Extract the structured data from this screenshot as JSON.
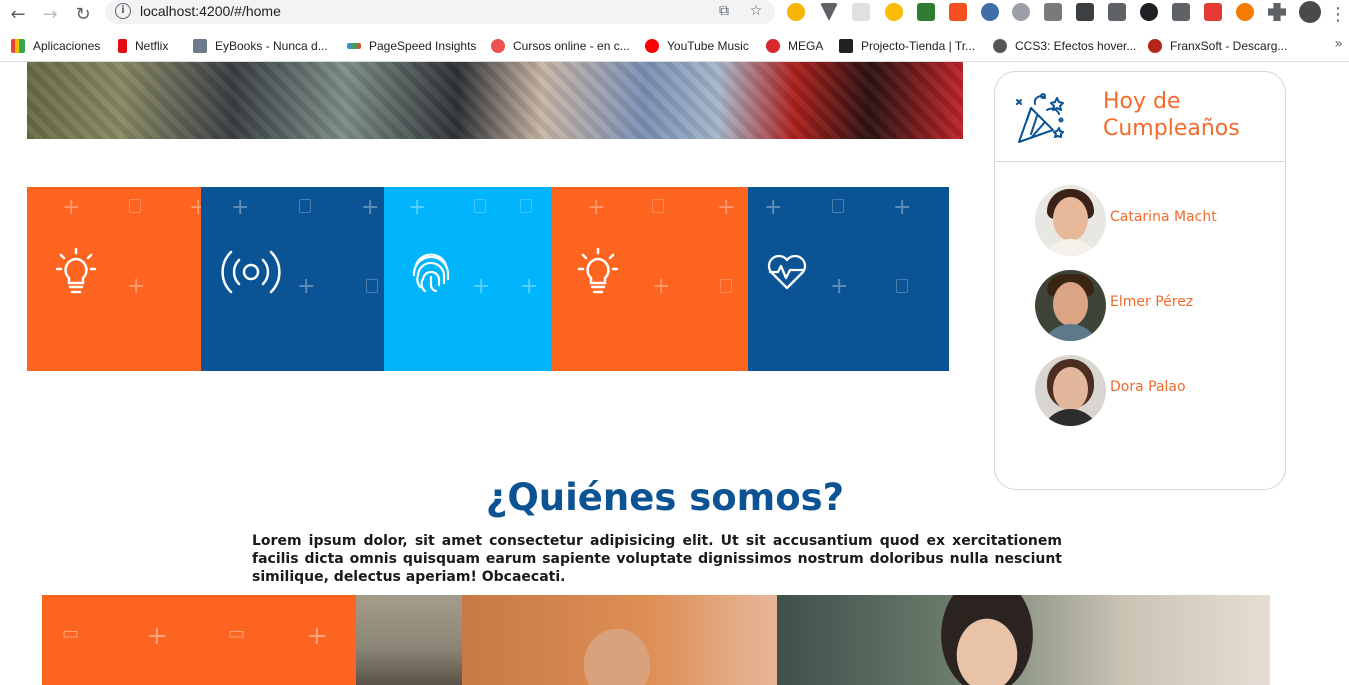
{
  "browser": {
    "url": "localhost:4200/#/home",
    "bookmarks": [
      {
        "label": "Aplicaciones",
        "color": "#4285f4"
      },
      {
        "label": "Netflix",
        "color": "#e50914"
      },
      {
        "label": "EyBooks - Nunca d...",
        "color": "#6d7b8d"
      },
      {
        "label": "PageSpeed Insights",
        "color": "#34a853"
      },
      {
        "label": "Cursos online - en c...",
        "color": "#ec5252"
      },
      {
        "label": "YouTube Music",
        "color": "#ff0000"
      },
      {
        "label": "MEGA",
        "color": "#d9272e"
      },
      {
        "label": "Projecto-Tienda | Tr...",
        "color": "#222222"
      },
      {
        "label": "CCS3: Efectos hover...",
        "color": "#555555"
      },
      {
        "label": "FranxSoft - Descarg...",
        "color": "#b3261e"
      }
    ],
    "more": "»"
  },
  "colors": {
    "orange": "#fd6420",
    "blue": "#0a5394",
    "light_blue": "#00b5fc",
    "accent": "#f26b2a",
    "heading": "#0c5394"
  },
  "tiles": [
    {
      "color": "#fd6420",
      "icon": "lightbulb-icon"
    },
    {
      "color": "#0a5394",
      "icon": "wireless-signal-icon"
    },
    {
      "color": "#00b5fc",
      "icon": "fingerprint-icon"
    },
    {
      "color": "#fd6420",
      "icon": "lightbulb-icon"
    },
    {
      "color": "#0a5394",
      "icon": "heart-pulse-icon"
    }
  ],
  "birthdays": {
    "title": "Hoy de Cumpleaños",
    "icon": "party-popper-icon",
    "people": [
      {
        "name": "Catarina Macht"
      },
      {
        "name": "Elmer Pérez"
      },
      {
        "name": "Dora Palao"
      }
    ]
  },
  "about": {
    "title": "¿Quiénes somos?",
    "text": "Lorem ipsum dolor, sit amet consectetur adipisicing elit. Ut sit accusantium quod ex xercitationem facilis dicta omnis quisquam earum sapiente voluptate dignissimos nostrum doloribus nulla nesciunt similique, delectus aperiam! Obcaecati."
  }
}
